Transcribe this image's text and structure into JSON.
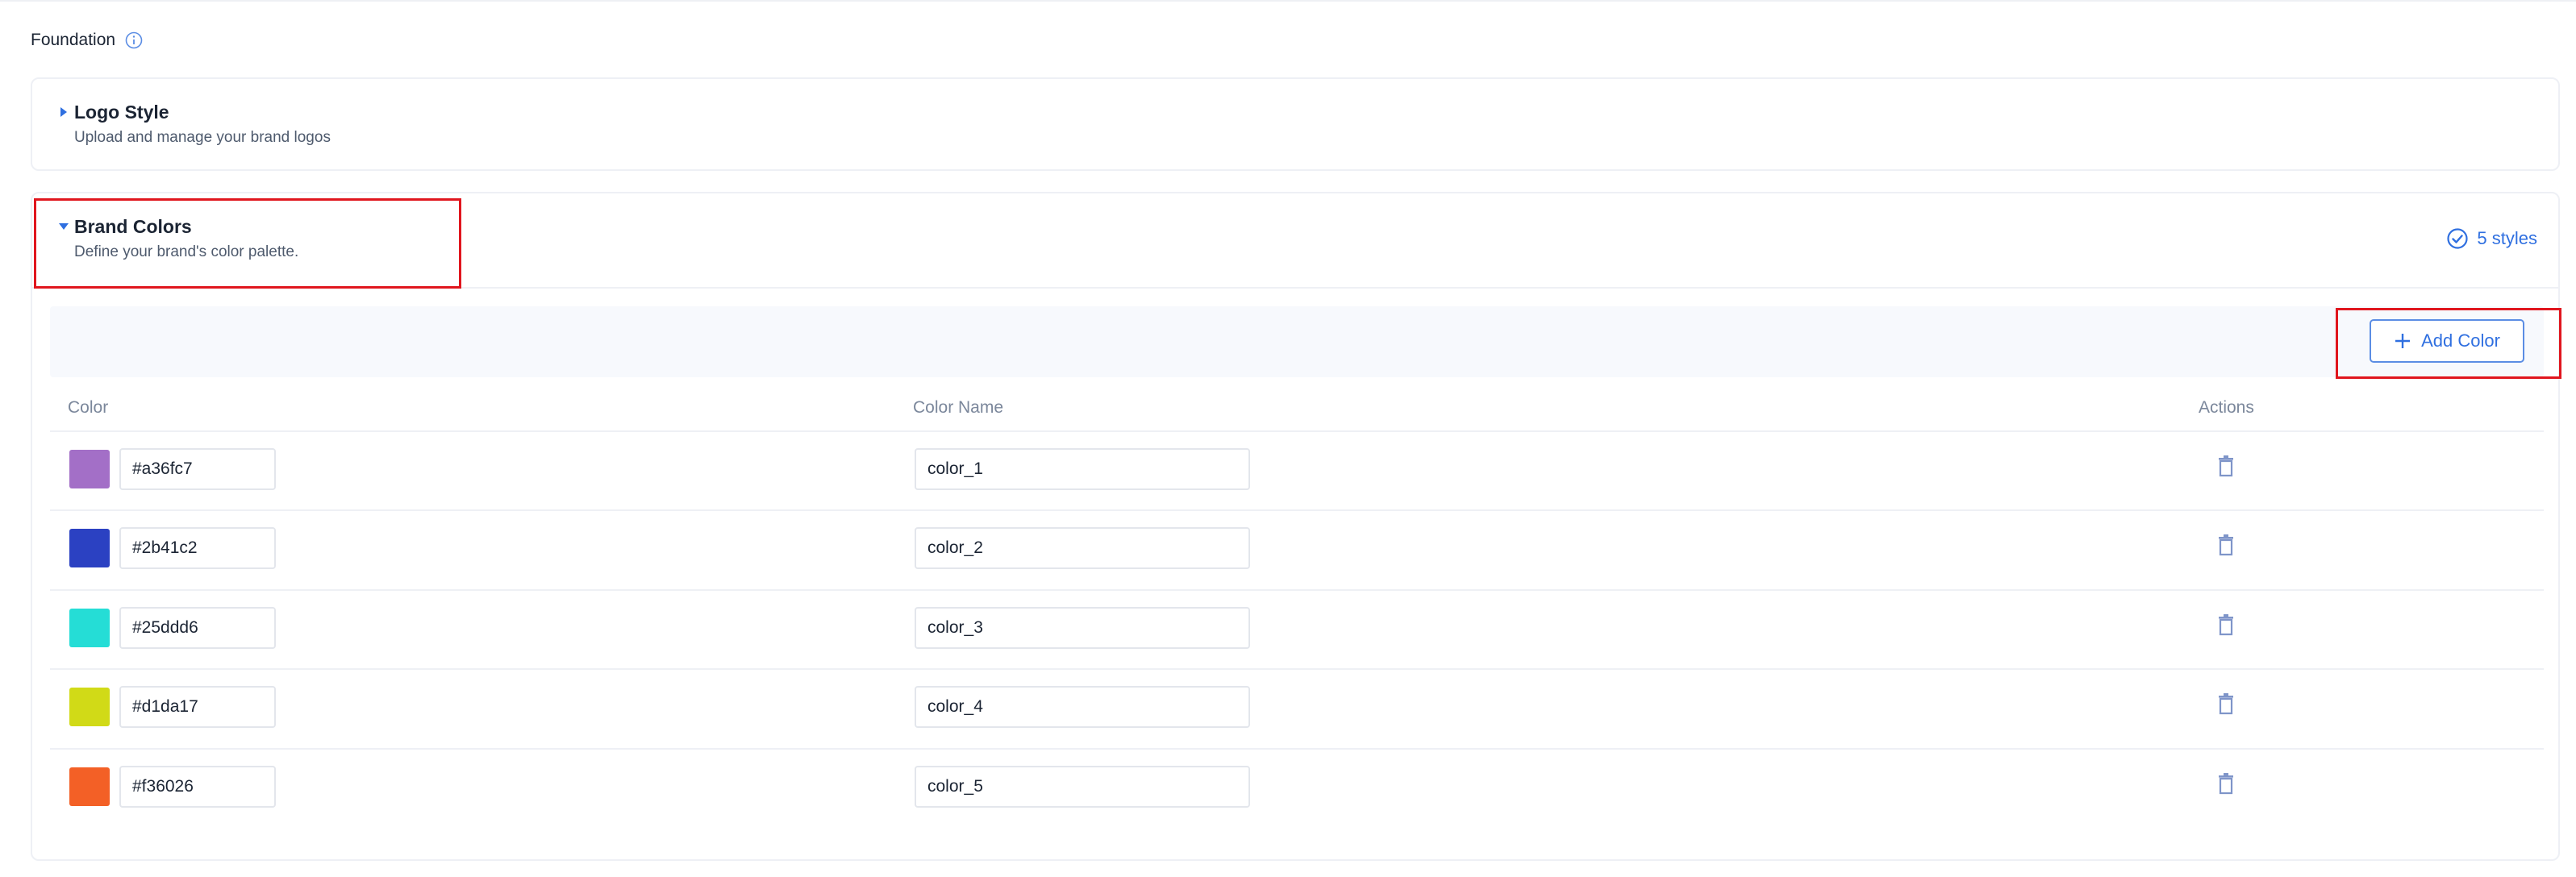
{
  "foundation": {
    "title": "Foundation",
    "info_icon": "info-circle-icon"
  },
  "logo_style": {
    "title": "Logo Style",
    "subtitle": "Upload and manage your brand logos",
    "expanded": false
  },
  "brand_colors": {
    "title": "Brand Colors",
    "subtitle": "Define your brand's color palette.",
    "expanded": true,
    "styles_count": "5 styles",
    "add_button_label": "Add Color",
    "columns": {
      "color": "Color",
      "name": "Color Name",
      "actions": "Actions"
    },
    "rows": [
      {
        "hex": "#a36fc7",
        "name": "color_1"
      },
      {
        "hex": "#2b41c2",
        "name": "color_2"
      },
      {
        "hex": "#25ddd6",
        "name": "color_3"
      },
      {
        "hex": "#d1da17",
        "name": "color_4"
      },
      {
        "hex": "#f36026",
        "name": "color_5"
      }
    ]
  },
  "theme": {
    "accent": "#2f6fe0",
    "highlight": "#e0161e",
    "trash_icon_color": "#7f95c9"
  }
}
